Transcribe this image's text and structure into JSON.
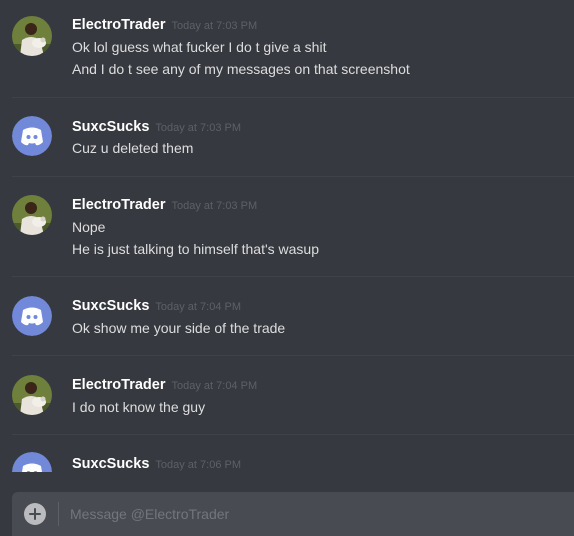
{
  "colors": {
    "background": "#36393f",
    "username": "#ffffff",
    "timestamp": "#5d6066",
    "message_text": "#dcddde",
    "blurple_avatar": "#7289da",
    "input_background": "#484b51"
  },
  "messages": [
    {
      "author": "ElectroTrader",
      "timestamp": "Today at 7:03 PM",
      "avatar": "photo-avatar",
      "lines": [
        "Ok lol guess what fucker I do t give a shit",
        "And I do t see any of my messages on that screenshot"
      ]
    },
    {
      "author": "SuxcSucks",
      "timestamp": "Today at 7:03 PM",
      "avatar": "discord-default-avatar-icon",
      "lines": [
        "Cuz u deleted them"
      ]
    },
    {
      "author": "ElectroTrader",
      "timestamp": "Today at 7:03 PM",
      "avatar": "photo-avatar",
      "lines": [
        "Nope",
        "He is just talking to himself that's wasup"
      ]
    },
    {
      "author": "SuxcSucks",
      "timestamp": "Today at 7:04 PM",
      "avatar": "discord-default-avatar-icon",
      "lines": [
        "Ok show me your side of the trade"
      ]
    },
    {
      "author": "ElectroTrader",
      "timestamp": "Today at 7:04 PM",
      "avatar": "photo-avatar",
      "lines": [
        "I do not know the guy"
      ]
    },
    {
      "author": "SuxcSucks",
      "timestamp": "Today at 7:06 PM",
      "avatar": "discord-default-avatar-icon",
      "lines": []
    }
  ],
  "composer": {
    "placeholder": "Message @ElectroTrader",
    "add_icon": "plus-circle-icon"
  }
}
